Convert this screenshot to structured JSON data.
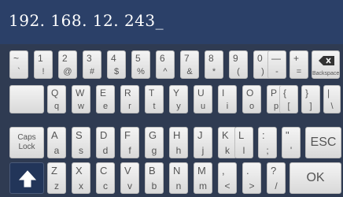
{
  "input": {
    "value": "192. 168. 12. 243_"
  },
  "rows": {
    "row1": [
      {
        "top": "~",
        "bot": "`"
      },
      {
        "top": "1",
        "bot": "!"
      },
      {
        "top": "2",
        "bot": "@"
      },
      {
        "top": "3",
        "bot": "#"
      },
      {
        "top": "4",
        "bot": "$"
      },
      {
        "top": "5",
        "bot": "%"
      },
      {
        "top": "6",
        "bot": "^"
      },
      {
        "top": "7",
        "bot": "&"
      },
      {
        "top": "8",
        "bot": "*"
      },
      {
        "top": "9",
        "bot": "("
      },
      {
        "top": "0",
        "bot": ")"
      },
      {
        "top": "—",
        "bot": "-"
      },
      {
        "top": "+",
        "bot": "="
      }
    ],
    "row2": [
      {
        "top": "Q",
        "bot": "q"
      },
      {
        "top": "W",
        "bot": "w"
      },
      {
        "top": "E",
        "bot": "e"
      },
      {
        "top": "R",
        "bot": "r"
      },
      {
        "top": "T",
        "bot": "t"
      },
      {
        "top": "Y",
        "bot": "y"
      },
      {
        "top": "U",
        "bot": "u"
      },
      {
        "top": "I",
        "bot": "i"
      },
      {
        "top": "O",
        "bot": "o"
      },
      {
        "top": "P",
        "bot": "p"
      },
      {
        "top": "{",
        "bot": "["
      },
      {
        "top": "}",
        "bot": "]"
      },
      {
        "top": "|",
        "bot": "\\"
      }
    ],
    "row3": [
      {
        "top": "A",
        "bot": "a"
      },
      {
        "top": "S",
        "bot": "s"
      },
      {
        "top": "D",
        "bot": "d"
      },
      {
        "top": "F",
        "bot": "f"
      },
      {
        "top": "G",
        "bot": "g"
      },
      {
        "top": "H",
        "bot": "h"
      },
      {
        "top": "J",
        "bot": "j"
      },
      {
        "top": "K",
        "bot": "k"
      },
      {
        "top": "L",
        "bot": "l"
      },
      {
        "top": ":",
        "bot": ";"
      },
      {
        "top": "\"",
        "bot": "'"
      }
    ],
    "row4": [
      {
        "top": "Z",
        "bot": "z"
      },
      {
        "top": "X",
        "bot": "x"
      },
      {
        "top": "C",
        "bot": "c"
      },
      {
        "top": "V",
        "bot": "v"
      },
      {
        "top": "B",
        "bot": "b"
      },
      {
        "top": "N",
        "bot": "n"
      },
      {
        "top": "M",
        "bot": "m"
      },
      {
        "top": ",",
        "bot": "<"
      },
      {
        "top": ".",
        "bot": ">"
      },
      {
        "top": "?",
        "bot": "/"
      }
    ]
  },
  "special": {
    "backspace_label": "Backspace",
    "caps_line1": "Caps",
    "caps_line2": "Lock",
    "shift_icon": "up-arrow",
    "esc_label": "ESC",
    "ok_label": "OK"
  },
  "colors": {
    "input_bg": "#2b4068",
    "keyboard_bg": "#2f3b52",
    "key_face": "#e8e8e8",
    "key_text": "#555555"
  }
}
